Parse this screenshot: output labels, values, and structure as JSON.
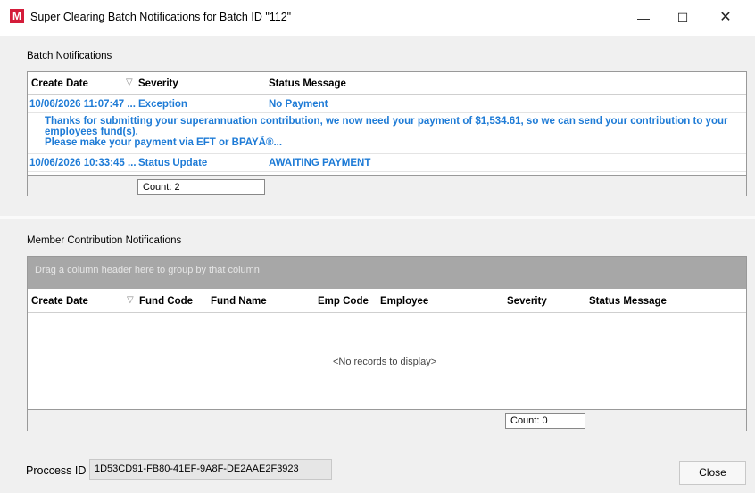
{
  "window": {
    "title": "Super Clearing Batch Notifications for Batch ID \"112\"",
    "app_icon_letter": "M",
    "minimize_glyph": "—",
    "maximize_glyph": "☐",
    "close_glyph": "✕"
  },
  "batch": {
    "section_label": "Batch Notifications",
    "columns": [
      "Create Date",
      "Severity",
      "Status Message"
    ],
    "rows": [
      {
        "create_date": "10/06/2026 11:07:47 ...",
        "severity": "Exception",
        "status_message": "No Payment",
        "detail_lines": [
          "Thanks for submitting your superannuation contribution, we now need your payment of $1,534.61, so we can send your contribution to your",
          "employees fund(s).",
          "Please make your payment via EFT or BPAYÂ®..."
        ]
      },
      {
        "create_date": "10/06/2026 10:33:45 ...",
        "severity": "Status Update",
        "status_message": "AWAITING PAYMENT"
      }
    ],
    "count": "Count: 2"
  },
  "member": {
    "section_label": "Member Contribution Notifications",
    "group_hint": "Drag a column header here to group by that column",
    "columns": [
      "Create Date",
      "Fund Code",
      "Fund Name",
      "Emp Code",
      "Employee",
      "Severity",
      "Status Message"
    ],
    "empty_text": "<No records to display>",
    "count": "Count: 0"
  },
  "footer": {
    "process_id_label": "Proccess ID",
    "process_id_value": "1D53CD91-FB80-41EF-9A8F-DE2AAE2F3923",
    "close_label": "Close"
  },
  "colors": {
    "row_text": "#1e7bd6",
    "app_icon": "#d41c3a",
    "group_bar": "#a7a7a7"
  }
}
